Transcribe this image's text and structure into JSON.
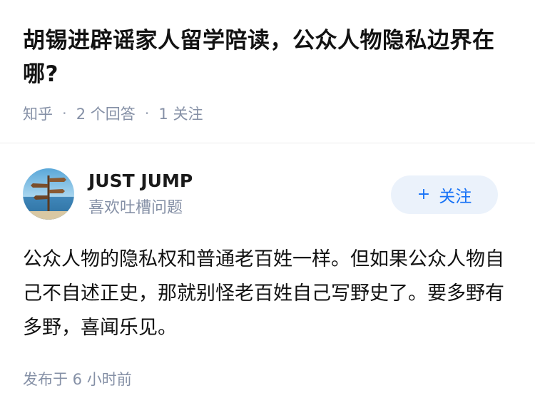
{
  "question": {
    "title": "胡锡进辟谣家人留学陪读，公众人物隐私边界在哪?",
    "source": "知乎",
    "answer_count": "2 个回答",
    "follower_count": "1 关注"
  },
  "answer": {
    "author": {
      "name": "JUST JUMP",
      "bio": "喜欢吐槽问题",
      "avatar_icon": "signpost-avatar"
    },
    "follow_button": {
      "label": "关注",
      "icon": "plus-icon"
    },
    "content": "公众人物的隐私权和普通老百姓一样。但如果公众人物自己不自述正史，那就别怪老百姓自己写野史了。要多野有多野，喜闻乐见。",
    "published": "发布于 6 小时前"
  },
  "colors": {
    "title_text": "#121212",
    "meta_text": "#8590a6",
    "accent": "#1772f6",
    "follow_bg": "#ebf2fb"
  }
}
